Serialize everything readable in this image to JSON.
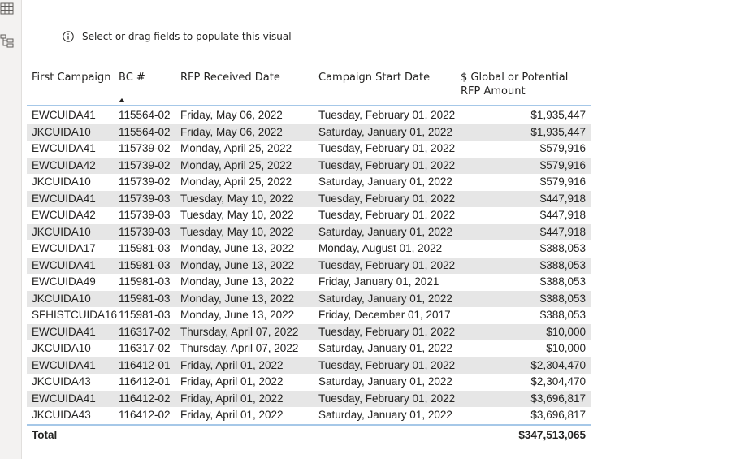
{
  "hint": {
    "text": "Select or drag fields to populate this visual"
  },
  "table": {
    "columns": [
      "First Campaign",
      "BC #",
      "RFP Received Date",
      "Campaign Start Date",
      "$ Global or Potential RFP Amount"
    ],
    "rows": [
      [
        "EWCUIDA41",
        "115564-02",
        "Friday, May 06, 2022",
        "Tuesday, February 01, 2022",
        "$1,935,447"
      ],
      [
        "JKCUIDA10",
        "115564-02",
        "Friday, May 06, 2022",
        "Saturday, January 01, 2022",
        "$1,935,447"
      ],
      [
        "EWCUIDA41",
        "115739-02",
        "Monday, April 25, 2022",
        "Tuesday, February 01, 2022",
        "$579,916"
      ],
      [
        "EWCUIDA42",
        "115739-02",
        "Monday, April 25, 2022",
        "Tuesday, February 01, 2022",
        "$579,916"
      ],
      [
        "JKCUIDA10",
        "115739-02",
        "Monday, April 25, 2022",
        "Saturday, January 01, 2022",
        "$579,916"
      ],
      [
        "EWCUIDA41",
        "115739-03",
        "Tuesday, May 10, 2022",
        "Tuesday, February 01, 2022",
        "$447,918"
      ],
      [
        "EWCUIDA42",
        "115739-03",
        "Tuesday, May 10, 2022",
        "Tuesday, February 01, 2022",
        "$447,918"
      ],
      [
        "JKCUIDA10",
        "115739-03",
        "Tuesday, May 10, 2022",
        "Saturday, January 01, 2022",
        "$447,918"
      ],
      [
        "EWCUIDA17",
        "115981-03",
        "Monday, June 13, 2022",
        "Monday, August 01, 2022",
        "$388,053"
      ],
      [
        "EWCUIDA41",
        "115981-03",
        "Monday, June 13, 2022",
        "Tuesday, February 01, 2022",
        "$388,053"
      ],
      [
        "EWCUIDA49",
        "115981-03",
        "Monday, June 13, 2022",
        "Friday, January 01, 2021",
        "$388,053"
      ],
      [
        "JKCUIDA10",
        "115981-03",
        "Monday, June 13, 2022",
        "Saturday, January 01, 2022",
        "$388,053"
      ],
      [
        "SFHISTCUIDA16",
        "115981-03",
        "Monday, June 13, 2022",
        "Friday, December 01, 2017",
        "$388,053"
      ],
      [
        "EWCUIDA41",
        "116317-02",
        "Thursday, April 07, 2022",
        "Tuesday, February 01, 2022",
        "$10,000"
      ],
      [
        "JKCUIDA10",
        "116317-02",
        "Thursday, April 07, 2022",
        "Saturday, January 01, 2022",
        "$10,000"
      ],
      [
        "EWCUIDA41",
        "116412-01",
        "Friday, April 01, 2022",
        "Tuesday, February 01, 2022",
        "$2,304,470"
      ],
      [
        "JKCUIDA43",
        "116412-01",
        "Friday, April 01, 2022",
        "Saturday, January 01, 2022",
        "$2,304,470"
      ],
      [
        "EWCUIDA41",
        "116412-02",
        "Friday, April 01, 2022",
        "Tuesday, February 01, 2022",
        "$3,696,817"
      ],
      [
        "JKCUIDA43",
        "116412-02",
        "Friday, April 01, 2022",
        "Saturday, January 01, 2022",
        "$3,696,817"
      ]
    ],
    "total": {
      "label": "Total",
      "amount": "$347,513,065"
    },
    "sort": {
      "column": "BC #",
      "direction": "ascending"
    }
  },
  "icons": [
    "table-icon",
    "hierarchy-icon",
    "info-icon",
    "sort-ascending-icon"
  ],
  "colors": {
    "header_border": "#a6c8e8",
    "alt_row": "#e6e6e6",
    "rail": "#f3f2f1"
  }
}
